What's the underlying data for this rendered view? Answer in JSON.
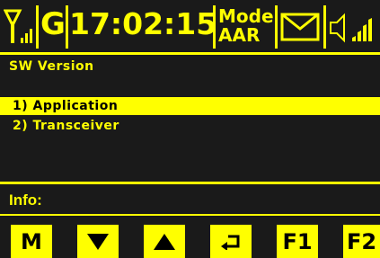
{
  "status_bar": {
    "signal_icon": "antenna-signal-icon",
    "network": "G",
    "time": "17:02:15",
    "mode_label": "Mode",
    "mode_value": "AAR",
    "message_icon": "envelope-icon",
    "volume_icon": "speaker-volume-icon"
  },
  "screen": {
    "title": "SW Version",
    "items": [
      {
        "label": "1) Application",
        "selected": true
      },
      {
        "label": "2) Transceiver",
        "selected": false
      }
    ],
    "info_label": "Info:"
  },
  "softkeys": [
    {
      "label": "M",
      "icon": null
    },
    {
      "label": "",
      "icon": "arrow-down-icon"
    },
    {
      "label": "",
      "icon": "arrow-up-icon"
    },
    {
      "label": "",
      "icon": "return-arrow-icon"
    },
    {
      "label": "F1",
      "icon": null
    },
    {
      "label": "F2",
      "icon": null
    }
  ],
  "colors": {
    "background": "#1a1a1a",
    "foreground": "#ffff00",
    "selected_text": "#000000"
  }
}
